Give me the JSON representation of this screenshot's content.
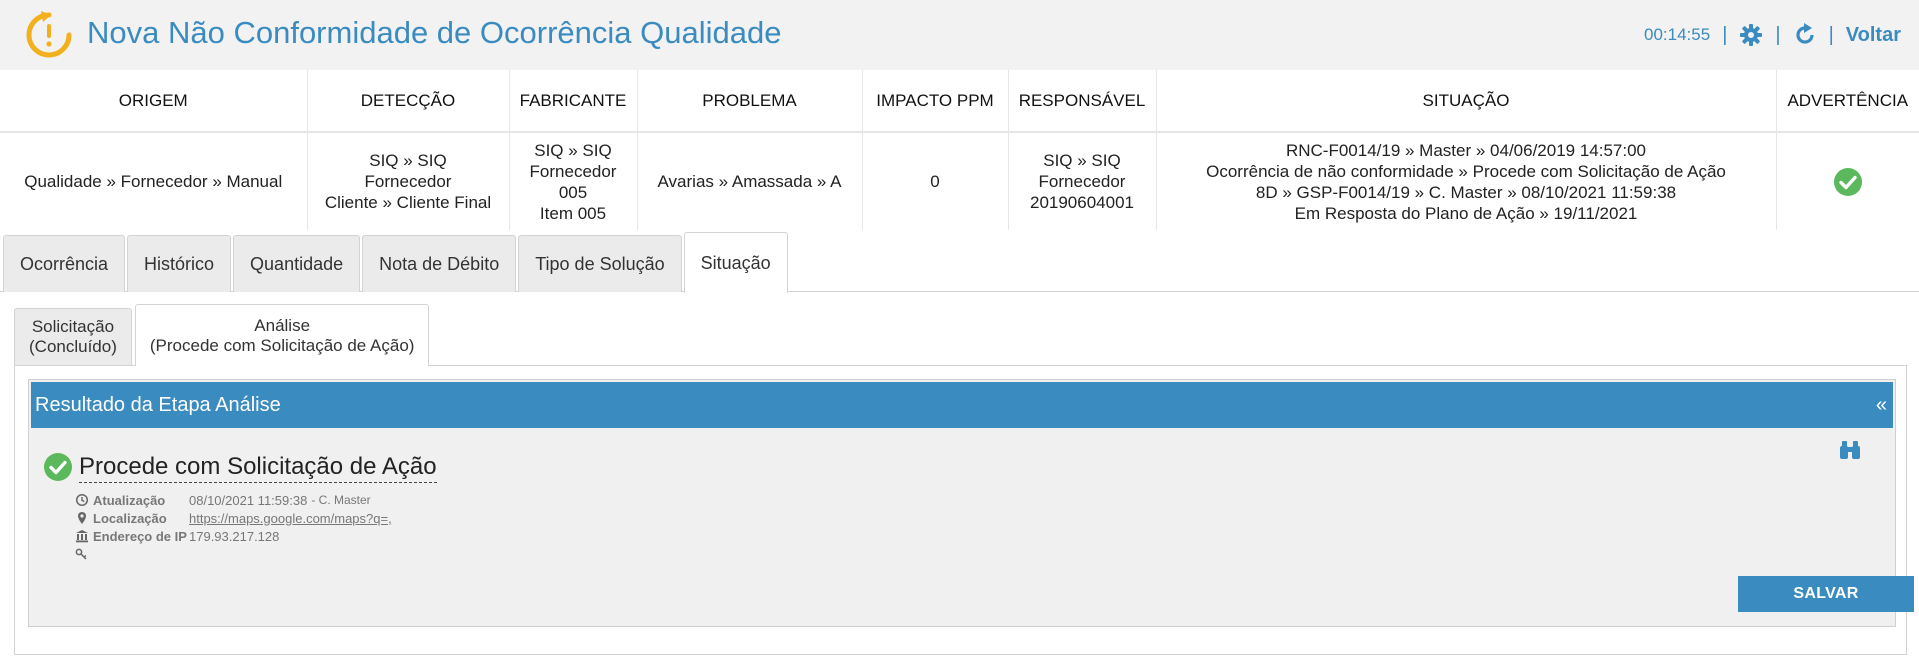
{
  "header": {
    "title": "Nova Não Conformidade de Ocorrência Qualidade",
    "timer": "00:14:55",
    "back_label": "Voltar",
    "accent": "#3a8bbf",
    "logo_color": "#f2b01e"
  },
  "summary": {
    "columns": [
      "ORIGEM",
      "DETECÇÃO",
      "FABRICANTE",
      "PROBLEMA",
      "IMPACTO PPM",
      "RESPONSÁVEL",
      "SITUAÇÃO",
      "ADVERTÊNCIA"
    ],
    "origem": "Qualidade » Fornecedor » Manual",
    "deteccao": [
      "SIQ » SIQ",
      "Fornecedor",
      "Cliente » Cliente Final"
    ],
    "fabricante": [
      "SIQ » SIQ",
      "Fornecedor",
      "005",
      "Item 005"
    ],
    "problema": "Avarias » Amassada » A",
    "impacto_ppm": "0",
    "responsavel": [
      "SIQ » SIQ",
      "Fornecedor",
      "20190604001"
    ],
    "situacao": [
      "RNC-F0014/19 » Master » 04/06/2019 14:57:00",
      "Ocorrência de não conformidade » Procede com Solicitação de Ação",
      "8D » GSP-F0014/19 » C. Master » 08/10/2021 11:59:38",
      "Em Resposta do Plano de Ação » 19/11/2021"
    ],
    "advertencia_icon": "green-check-icon",
    "ok_color": "#5cb85c"
  },
  "tabs": [
    {
      "label": "Ocorrência"
    },
    {
      "label": "Histórico"
    },
    {
      "label": "Quantidade"
    },
    {
      "label": "Nota de Débito"
    },
    {
      "label": "Tipo de Solução"
    },
    {
      "label": "Situação",
      "active": true
    }
  ],
  "subtabs": [
    {
      "line1": "Solicitação",
      "line2": "(Concluído)"
    },
    {
      "line1": "Análise",
      "line2": "(Procede com Solicitação de Ação)",
      "active": true
    }
  ],
  "card": {
    "title": "Resultado da Etapa Análise",
    "collapse": "«",
    "result": "Procede com Solicitação de Ação",
    "meta": {
      "atualizacao_label": "Atualização",
      "atualizacao_value": "08/10/2021 11:59:38",
      "atualizacao_user": "- C. Master",
      "localizacao_label": "Localização",
      "localizacao_value": "https://maps.google.com/maps?q=,",
      "ip_label": "Endereço de IP",
      "ip_value": "179.93.217.128"
    },
    "save_label": "SALVAR"
  }
}
